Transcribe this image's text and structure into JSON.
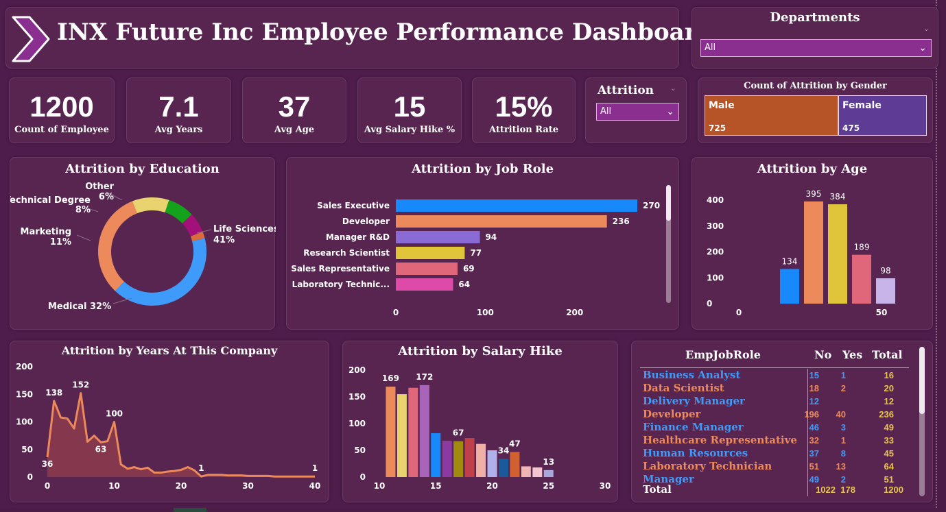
{
  "header": {
    "title": "INX Future Inc Employee Performance Dashboard"
  },
  "departments_slicer": {
    "label": "Departments",
    "value": "All"
  },
  "attrition_slicer": {
    "label": "Attrition",
    "value": "All"
  },
  "kpis": [
    {
      "value": "1200",
      "label": "Count of Employee"
    },
    {
      "value": "7.1",
      "label": "Avg Years"
    },
    {
      "value": "37",
      "label": "Avg Age"
    },
    {
      "value": "15",
      "label": "Avg Salary Hike %"
    },
    {
      "value": "15%",
      "label": "Attrition Rate"
    }
  ],
  "gender_card": {
    "title": "Count of Attrition by Gender",
    "male": {
      "label": "Male",
      "value": "725",
      "color": "#b65428"
    },
    "female": {
      "label": "Female",
      "value": "475",
      "color": "#5e3c96"
    }
  },
  "chart_data": [
    {
      "id": "education",
      "type": "pie",
      "title": "Attrition by Education",
      "slices": [
        {
          "label": "Life Sciences",
          "pct_label": "41%",
          "value": 41,
          "color": "#3e9bfa"
        },
        {
          "label": "Medical",
          "pct_label": "32%",
          "value": 32,
          "color": "#ec8a5c"
        },
        {
          "label": "Marketing",
          "pct_label": "11%",
          "value": 11,
          "color": "#e9d36e"
        },
        {
          "label": "Technical Degree",
          "pct_label": "8%",
          "value": 8,
          "color": "#14a21c"
        },
        {
          "label": "Other",
          "pct_label": "6%",
          "value": 6,
          "color": "#a3107a"
        },
        {
          "label": "",
          "pct_label": "",
          "value": 2,
          "color": "#d86c3c"
        }
      ],
      "label_texts": {
        "life_sciences": "Life Sciences",
        "life_sciences_pct": "41%",
        "medical": "Medical 32%",
        "marketing": "Marketing",
        "marketing_pct": "11%",
        "technical": "Technical Degree",
        "technical_pct": "8%",
        "other": "Other",
        "other_pct": "6%"
      }
    },
    {
      "id": "jobrole",
      "type": "bar",
      "orientation": "horizontal",
      "title": "Attrition by Job Role",
      "categories": [
        "Sales Executive",
        "Developer",
        "Manager R&D",
        "Research Scientist",
        "Sales Representative",
        "Laboratory Technic..."
      ],
      "values": [
        270,
        236,
        94,
        77,
        69,
        64
      ],
      "colors": [
        "#1889fb",
        "#ec8a5c",
        "#8a6ad4",
        "#e0c43a",
        "#e0667a",
        "#dd4aa8"
      ],
      "x_ticks": [
        "0",
        "100",
        "200"
      ],
      "xlim": [
        0,
        270
      ]
    },
    {
      "id": "age",
      "type": "bar",
      "title": "Attrition by Age",
      "values": [
        134,
        395,
        384,
        189,
        98
      ],
      "colors": [
        "#1889fb",
        "#ec8a5c",
        "#e0c43a",
        "#e0667a",
        "#c9b4ea"
      ],
      "y_ticks": [
        "0",
        "100",
        "200",
        "300",
        "400"
      ],
      "x_ticks": [
        "0",
        "50"
      ],
      "ylim": [
        0,
        400
      ]
    },
    {
      "id": "years",
      "type": "area",
      "title": "Attrition by Years At This Company",
      "x": [
        0,
        1,
        2,
        3,
        4,
        5,
        6,
        7,
        8,
        9,
        10,
        11,
        12,
        13,
        14,
        15,
        16,
        17,
        18,
        19,
        20,
        21,
        22,
        23,
        24,
        25,
        26,
        27,
        28,
        29,
        30,
        31,
        32,
        33,
        34,
        35,
        36,
        37,
        38,
        39,
        40
      ],
      "y": [
        36,
        138,
        108,
        106,
        88,
        152,
        64,
        75,
        63,
        65,
        100,
        23,
        15,
        18,
        14,
        17,
        8,
        8,
        10,
        11,
        13,
        18,
        12,
        1,
        4,
        4,
        4,
        3,
        3,
        3,
        2,
        2,
        2,
        2,
        1,
        1,
        1,
        1,
        1,
        1,
        1
      ],
      "labels": [
        {
          "x": 0,
          "y": 36,
          "text": "36"
        },
        {
          "x": 1,
          "y": 138,
          "text": "138"
        },
        {
          "x": 5,
          "y": 152,
          "text": "152"
        },
        {
          "x": 8,
          "y": 63,
          "text": "63"
        },
        {
          "x": 10,
          "y": 100,
          "text": "100"
        },
        {
          "x": 23,
          "y": 1,
          "text": "1"
        },
        {
          "x": 40,
          "y": 1,
          "text": "1"
        }
      ],
      "y_ticks": [
        "0",
        "50",
        "100",
        "150",
        "200"
      ],
      "x_ticks": [
        "0",
        "10",
        "20",
        "30",
        "40"
      ],
      "ylim": [
        0,
        200
      ],
      "xlim": [
        0,
        40
      ],
      "color": "#ec8a5c"
    },
    {
      "id": "hike",
      "type": "bar",
      "title": "Attrition by Salary Hike",
      "x": [
        11,
        12,
        13,
        14,
        15,
        16,
        17,
        18,
        19,
        20,
        21,
        22,
        23,
        24,
        25
      ],
      "values": [
        169,
        155,
        167,
        172,
        82,
        68,
        67,
        73,
        62,
        50,
        34,
        47,
        20,
        18,
        13
      ],
      "colors": [
        "#ec8a5c",
        "#e9d36e",
        "#e0667a",
        "#a764b8",
        "#1889fb",
        "#8a3aa0",
        "#a08a10",
        "#c0404a",
        "#f0b0a8",
        "#b0b0ea",
        "#1a5a9a",
        "#d06030",
        "#f0b4b4",
        "#f4c4d0",
        "#a8a8dc"
      ],
      "data_labels": [
        {
          "x": 11,
          "text": "169"
        },
        {
          "x": 14,
          "text": "172"
        },
        {
          "x": 17,
          "text": "67"
        },
        {
          "x": 21,
          "text": "34"
        },
        {
          "x": 22,
          "text": "47"
        },
        {
          "x": 25,
          "text": "13"
        }
      ],
      "y_ticks": [
        "0",
        "50",
        "100",
        "150",
        "200"
      ],
      "x_ticks": [
        "10",
        "15",
        "20",
        "25",
        "30"
      ],
      "ylim": [
        0,
        200
      ],
      "xlim": [
        10,
        30
      ]
    }
  ],
  "emp_table": {
    "headers": {
      "role": "EmpJobRole",
      "no": "No",
      "yes": "Yes",
      "total": "Total"
    },
    "rows": [
      {
        "role": "Business Analyst",
        "no": "15",
        "yes": "1",
        "total": "16",
        "color": "#3e9bfa"
      },
      {
        "role": "Data Scientist",
        "no": "18",
        "yes": "2",
        "total": "20",
        "color": "#ec8a5c"
      },
      {
        "role": "Delivery Manager",
        "no": "12",
        "yes": "",
        "total": "12",
        "color": "#3e9bfa"
      },
      {
        "role": "Developer",
        "no": "196",
        "yes": "40",
        "total": "236",
        "color": "#ec8a5c"
      },
      {
        "role": "Finance Manager",
        "no": "46",
        "yes": "3",
        "total": "49",
        "color": "#3e9bfa"
      },
      {
        "role": "Healthcare Representative",
        "no": "32",
        "yes": "1",
        "total": "33",
        "color": "#ec8a5c"
      },
      {
        "role": "Human Resources",
        "no": "37",
        "yes": "8",
        "total": "45",
        "color": "#3e9bfa"
      },
      {
        "role": "Laboratory Technician",
        "no": "51",
        "yes": "13",
        "total": "64",
        "color": "#ec8a5c"
      },
      {
        "role": "Manager",
        "no": "49",
        "yes": "2",
        "total": "51",
        "color": "#3e9bfa"
      }
    ],
    "total": {
      "role": "Total",
      "no": "1022",
      "yes": "178",
      "total": "1200"
    },
    "total_color": "#e9c44a"
  }
}
